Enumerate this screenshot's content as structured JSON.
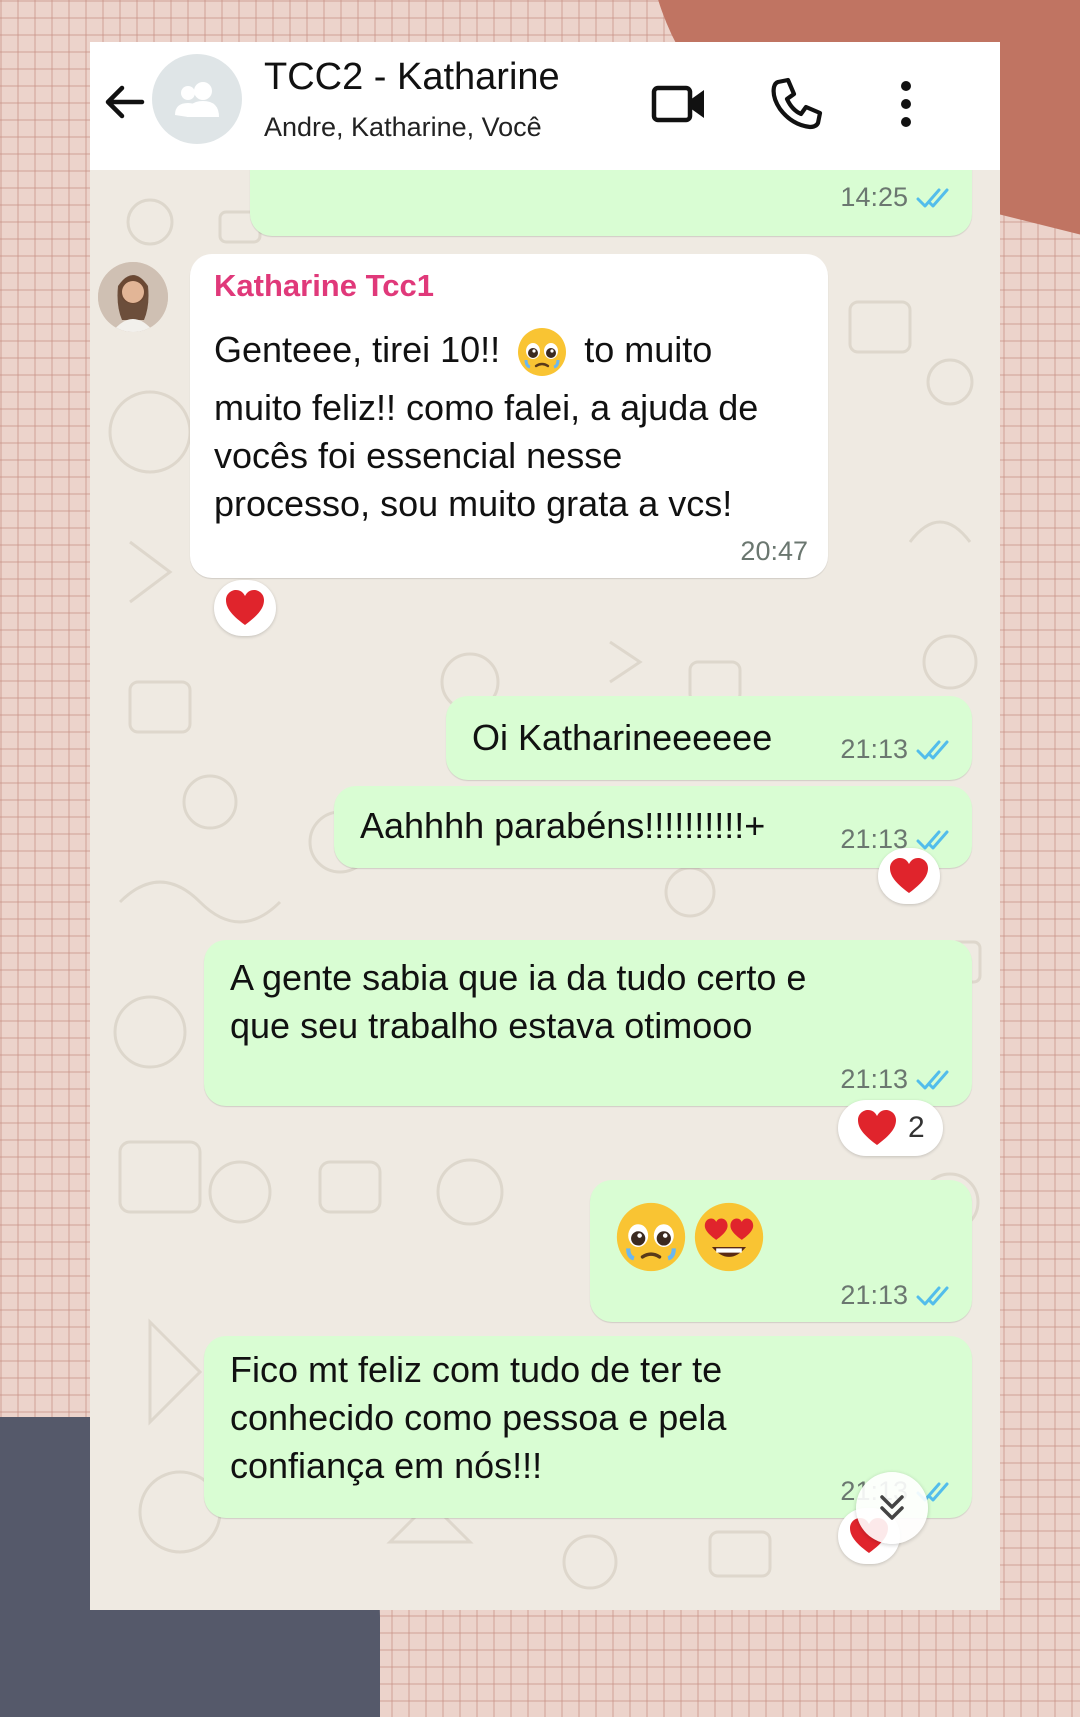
{
  "header": {
    "title": "TCC2 - Katharine",
    "subtitle": "Andre, Katharine, Você",
    "icons": [
      "back-arrow-icon",
      "group-avatar-icon",
      "video-call-icon",
      "voice-call-icon",
      "more-options-icon"
    ]
  },
  "messages": [
    {
      "direction": "out",
      "text": "",
      "time": "14:25",
      "status": "read"
    },
    {
      "direction": "in",
      "sender": "Katharine Tcc1",
      "lines": [
        "Genteee, tirei 10!!",
        "to muito",
        "muito feliz!! como falei, a ajuda de",
        "vocês foi essencial nesse",
        "processo, sou muito grata a vcs!"
      ],
      "emoji": "pleading-face",
      "time": "20:47",
      "reaction": "❤️"
    },
    {
      "direction": "out",
      "text": "Oi Katharineeeeee",
      "time": "21:13",
      "status": "read"
    },
    {
      "direction": "out",
      "text": "Aahhhh parabéns!!!!!!!!!!+",
      "time": "21:13",
      "status": "read",
      "reaction": "❤️"
    },
    {
      "direction": "out",
      "lines": [
        "A gente sabia que ia da tudo certo e",
        "que seu trabalho estava otimooo"
      ],
      "time": "21:13",
      "status": "read",
      "reaction": "❤️",
      "reaction_count": "2"
    },
    {
      "direction": "out",
      "emojis": [
        "pleading-face",
        "heart-eyes-face"
      ],
      "time": "21:13",
      "status": "read"
    },
    {
      "direction": "out",
      "lines": [
        "Fico mt feliz com tudo de ter te",
        "conhecido como pessoa e pela",
        "confiança em nós!!!"
      ],
      "time": "21:13",
      "status": "read",
      "reaction": "❤️"
    }
  ],
  "colors": {
    "outgoing_bubble": "#d9fdd3",
    "incoming_bubble": "#ffffff",
    "sender_name": "#e0397a",
    "read_ticks": "#53bdeb",
    "heart": "#e0242c"
  },
  "scroll_button": {
    "icon": "chevron-double-down-icon"
  }
}
